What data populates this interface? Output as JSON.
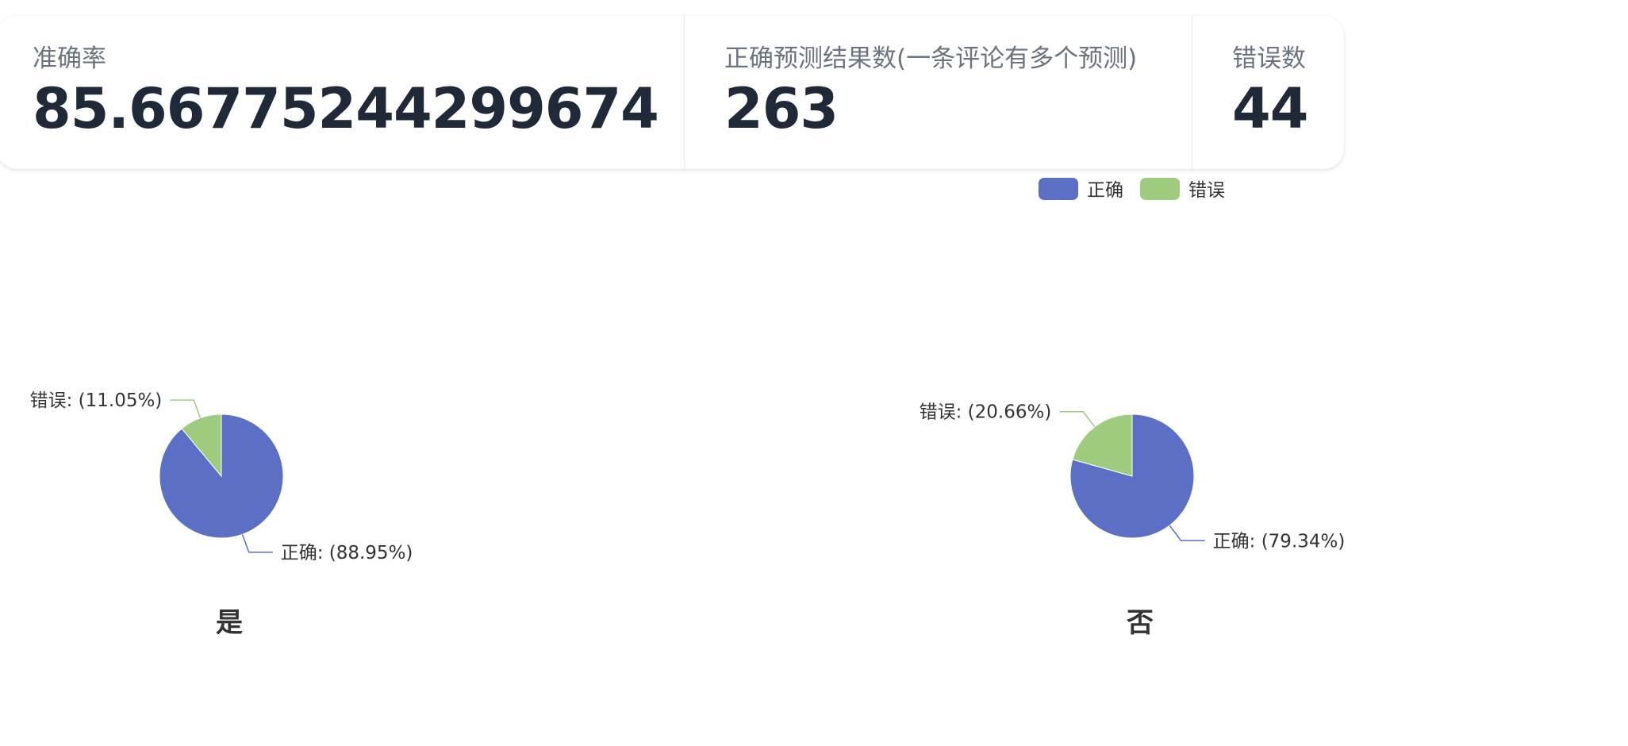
{
  "stats": [
    {
      "title": "准确率",
      "value": "85.66775244299674"
    },
    {
      "title": "正确预测结果数(一条评论有多个预测)",
      "value": "263"
    },
    {
      "title": "错误数",
      "value": "44"
    }
  ],
  "colors": {
    "correct": "#5b70c4",
    "wrong": "#9fcb7f"
  },
  "legend": [
    {
      "name": "正确",
      "color": "#5b70c4"
    },
    {
      "name": "错误",
      "color": "#9fcb7f"
    }
  ],
  "chart_data": [
    {
      "type": "pie",
      "title": "是",
      "slices": [
        {
          "name": "正确",
          "percent": 88.95,
          "label": "正确: (88.95%)"
        },
        {
          "name": "错误",
          "percent": 11.05,
          "label": "错误: (11.05%)"
        }
      ]
    },
    {
      "type": "pie",
      "title": "否",
      "slices": [
        {
          "name": "正确",
          "percent": 79.34,
          "label": "正确: (79.34%)"
        },
        {
          "name": "错误",
          "percent": 20.66,
          "label": "错误: (20.66%)"
        }
      ]
    }
  ]
}
